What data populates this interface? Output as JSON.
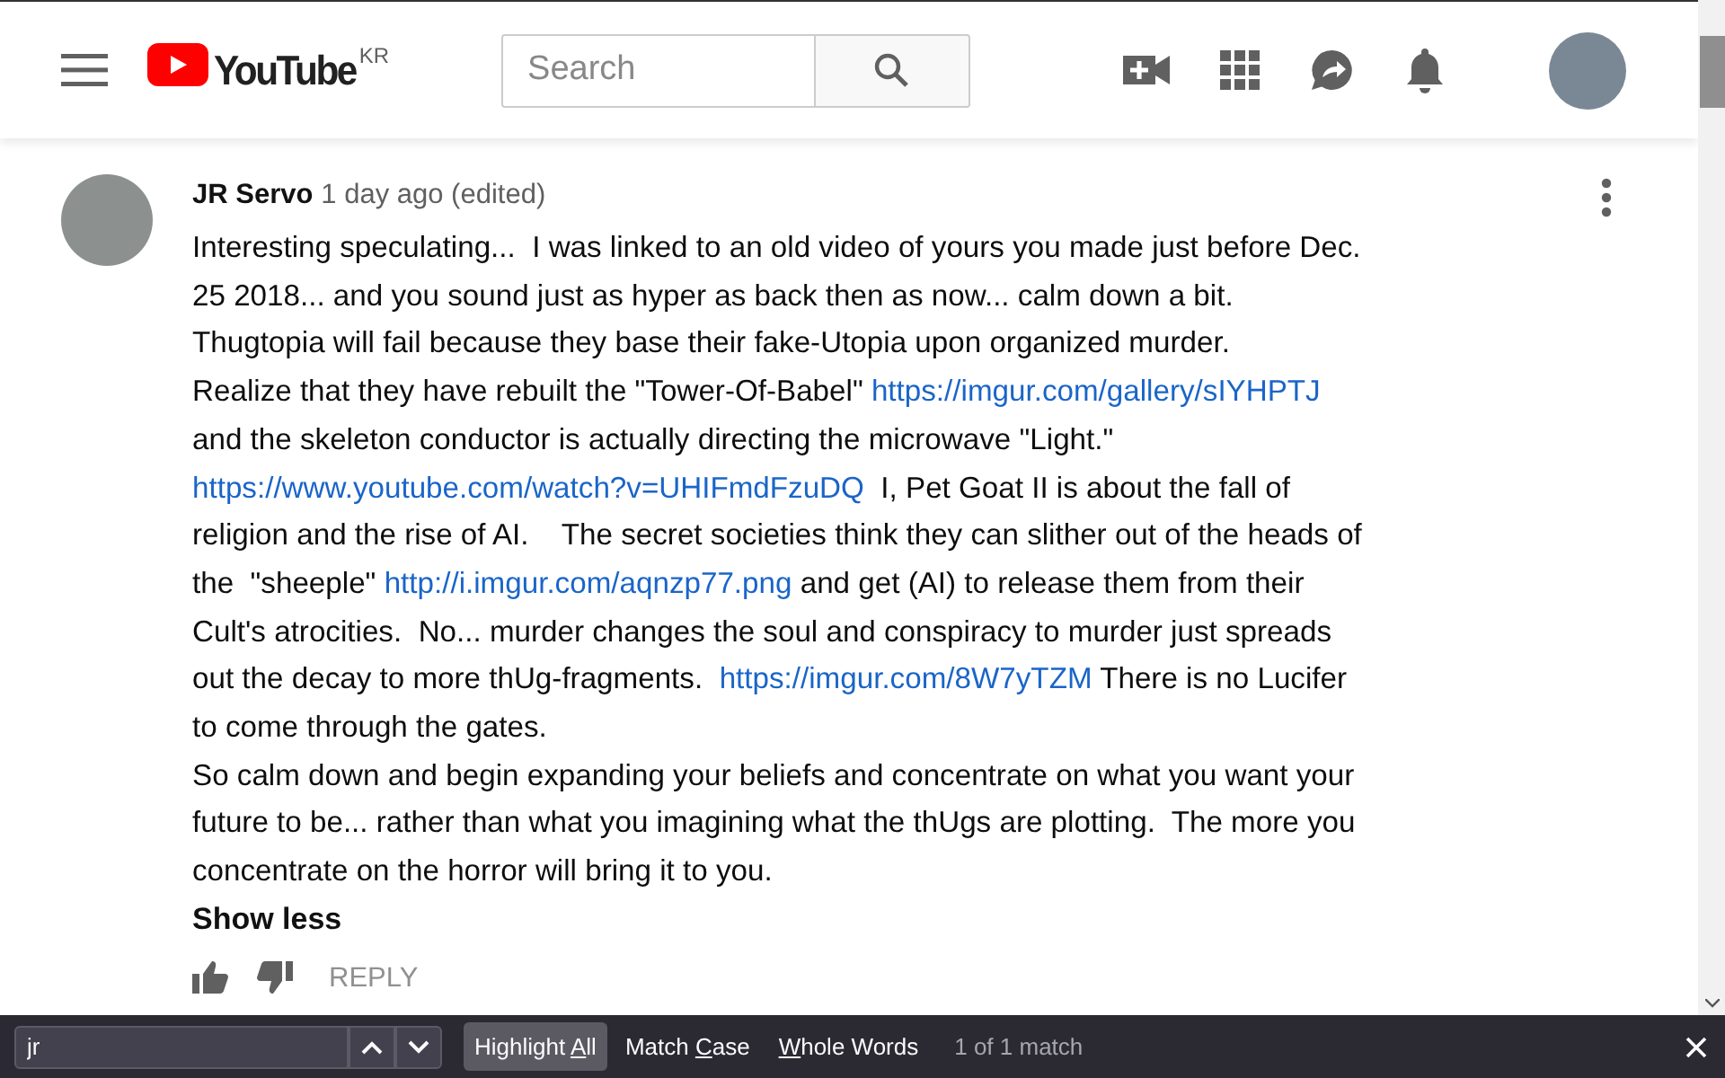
{
  "header": {
    "logo_text": "YouTube",
    "region": "KR",
    "search": {
      "placeholder": "Search"
    }
  },
  "comment": {
    "author": "JR Servo",
    "time": "1 day ago (edited)",
    "lines": [
      [
        {
          "kind": "text",
          "text": "Interesting speculating...  I was linked to an old video of yours you made just before Dec."
        }
      ],
      [
        {
          "kind": "text",
          "text": "25 2018... and you sound just as hyper as back then as now... calm down a bit."
        }
      ],
      [
        {
          "kind": "text",
          "text": "Thugtopia will fail because they base their fake-Utopia upon organized murder."
        }
      ],
      [
        {
          "kind": "text",
          "text": "Realize that they have rebuilt the \"Tower-Of-Babel\" "
        },
        {
          "kind": "link",
          "text": "https://imgur.com/gallery/sIYHPTJ"
        }
      ],
      [
        {
          "kind": "text",
          "text": "and the skeleton conductor is actually directing the microwave \"Light.\""
        }
      ],
      [
        {
          "kind": "link",
          "text": "https://www.youtube.com/watch?v=UHIFmdFzuDQ"
        },
        {
          "kind": "text",
          "text": "  I, Pet Goat II is about the fall of"
        }
      ],
      [
        {
          "kind": "text",
          "text": "religion and the rise of AI.    The secret societies think they can slither out of the heads of"
        }
      ],
      [
        {
          "kind": "text",
          "text": "the  \"sheeple\" "
        },
        {
          "kind": "link",
          "text": "http://i.imgur.com/aqnzp77.png"
        },
        {
          "kind": "text",
          "text": " and get (AI) to release them from their"
        }
      ],
      [
        {
          "kind": "text",
          "text": "Cult's atrocities.  No... murder changes the soul and conspiracy to murder just spreads"
        }
      ],
      [
        {
          "kind": "text",
          "text": "out the decay to more thUg-fragments.  "
        },
        {
          "kind": "link",
          "text": "https://imgur.com/8W7yTZM"
        },
        {
          "kind": "text",
          "text": " There is no Lucifer"
        }
      ],
      [
        {
          "kind": "text",
          "text": "to come through the gates."
        }
      ],
      [
        {
          "kind": "text",
          "text": "So calm down and begin expanding your beliefs and concentrate on what you want your"
        }
      ],
      [
        {
          "kind": "text",
          "text": "future to be... rather than what you imagining what the thUgs are plotting.  The more you"
        }
      ],
      [
        {
          "kind": "text",
          "text": "concentrate on the horror will bring it to you."
        }
      ]
    ],
    "toggle": "Show less",
    "reply": "REPLY"
  },
  "find_bar": {
    "query": "jr",
    "options": [
      {
        "before": "Highlight ",
        "key": "A",
        "after": "ll",
        "selected": true
      },
      {
        "before": "Match ",
        "key": "C",
        "after": "ase",
        "selected": false
      },
      {
        "key": "W",
        "after": "hole Words",
        "selected": false
      }
    ],
    "status": "1 of 1 match"
  }
}
